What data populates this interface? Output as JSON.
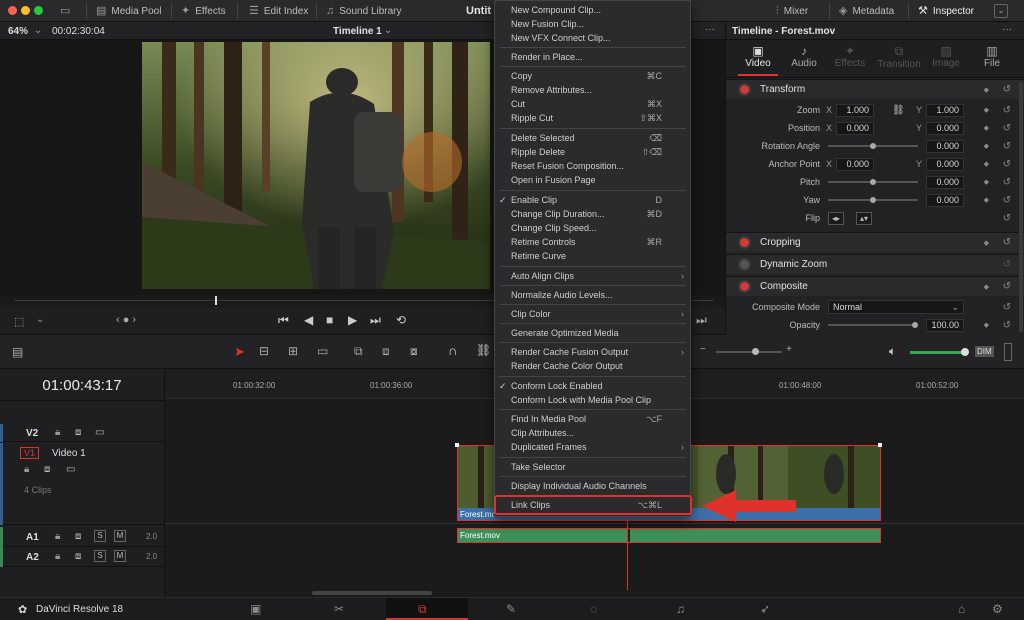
{
  "topbar": {
    "media_pool": "Media Pool",
    "effects": "Effects",
    "edit_index": "Edit Index",
    "sound_library": "Sound Library",
    "project_title": "Untit",
    "mixer": "Mixer",
    "metadata": "Metadata",
    "inspector": "Inspector"
  },
  "viewer": {
    "zoom": "64%",
    "timecode": "00:02:30:04",
    "timeline_name": "Timeline 1",
    "more": "···"
  },
  "inspector": {
    "title": "Timeline - Forest.mov",
    "more": "···",
    "tabs": [
      "Video",
      "Audio",
      "Effects",
      "Transition",
      "Image",
      "File"
    ],
    "active_tab": "Video",
    "transform": {
      "title": "Transform",
      "zoom_label": "Zoom",
      "zoom_x": "1.000",
      "zoom_y": "1.000",
      "position_label": "Position",
      "position_x": "0.000",
      "position_y": "0.000",
      "rotation_label": "Rotation Angle",
      "rotation": "0.000",
      "anchor_label": "Anchor Point",
      "anchor_x": "0.000",
      "anchor_y": "0.000",
      "pitch_label": "Pitch",
      "pitch": "0.000",
      "yaw_label": "Yaw",
      "yaw": "0.000",
      "flip_label": "Flip",
      "x": "X",
      "y": "Y"
    },
    "cropping": "Cropping",
    "dynamic_zoom": "Dynamic Zoom",
    "composite": {
      "title": "Composite",
      "mode_label": "Composite Mode",
      "mode_value": "Normal",
      "opacity_label": "Opacity",
      "opacity_value": "100.00"
    }
  },
  "timeline": {
    "timecode": "01:00:43:17",
    "ruler": [
      "01:00:32:00",
      "01:00:36:00",
      "01:00:48:00",
      "01:00:52:00"
    ],
    "v2": "V2",
    "v1": "V1",
    "v1_name": "Video 1",
    "v1_clips": "4 Clips",
    "a1": "A1",
    "a2": "A2",
    "a_level": "2.0",
    "clip_video": "Forest.mov",
    "clip_audio": "Forest.mov",
    "solo": "S",
    "mute": "M",
    "dim": "DIM"
  },
  "context_menu": {
    "items": [
      {
        "label": "New Compound Clip...",
        "shortcut": ""
      },
      {
        "label": "New Fusion Clip...",
        "shortcut": ""
      },
      {
        "label": "New VFX Connect Clip...",
        "shortcut": ""
      },
      {
        "label": "Render in Place...",
        "shortcut": ""
      },
      {
        "label": "Copy",
        "shortcut": "⌘C"
      },
      {
        "label": "Remove Attributes...",
        "shortcut": ""
      },
      {
        "label": "Cut",
        "shortcut": "⌘X"
      },
      {
        "label": "Ripple Cut",
        "shortcut": "⇧⌘X"
      },
      {
        "label": "Delete Selected",
        "shortcut": "⌫"
      },
      {
        "label": "Ripple Delete",
        "shortcut": "⇧⌫"
      },
      {
        "label": "Reset Fusion Composition...",
        "shortcut": ""
      },
      {
        "label": "Open in Fusion Page",
        "shortcut": ""
      },
      {
        "label": "Enable Clip",
        "shortcut": "D"
      },
      {
        "label": "Change Clip Duration...",
        "shortcut": "⌘D"
      },
      {
        "label": "Change Clip Speed...",
        "shortcut": ""
      },
      {
        "label": "Retime Controls",
        "shortcut": "⌘R"
      },
      {
        "label": "Retime Curve",
        "shortcut": ""
      },
      {
        "label": "Auto Align Clips",
        "shortcut": ""
      },
      {
        "label": "Normalize Audio Levels...",
        "shortcut": ""
      },
      {
        "label": "Clip Color",
        "shortcut": ""
      },
      {
        "label": "Generate Optimized Media",
        "shortcut": ""
      },
      {
        "label": "Render Cache Fusion Output",
        "shortcut": ""
      },
      {
        "label": "Render Cache Color Output",
        "shortcut": ""
      },
      {
        "label": "Conform Lock Enabled",
        "shortcut": ""
      },
      {
        "label": "Conform Lock with Media Pool Clip",
        "shortcut": ""
      },
      {
        "label": "Find In Media Pool",
        "shortcut": "⌥F"
      },
      {
        "label": "Clip Attributes...",
        "shortcut": ""
      },
      {
        "label": "Duplicated Frames",
        "shortcut": ""
      },
      {
        "label": "Take Selector",
        "shortcut": ""
      },
      {
        "label": "Display Individual Audio Channels",
        "shortcut": ""
      },
      {
        "label": "Link Clips",
        "shortcut": "⌥⌘L"
      }
    ]
  },
  "statusbar": {
    "app_name": "DaVinci Resolve 18"
  },
  "colors": {
    "accent_red": "#e0322c",
    "clip_blue": "#3d6fa8",
    "audio_green": "#3f8f5a",
    "playhead": "#e0322c"
  }
}
